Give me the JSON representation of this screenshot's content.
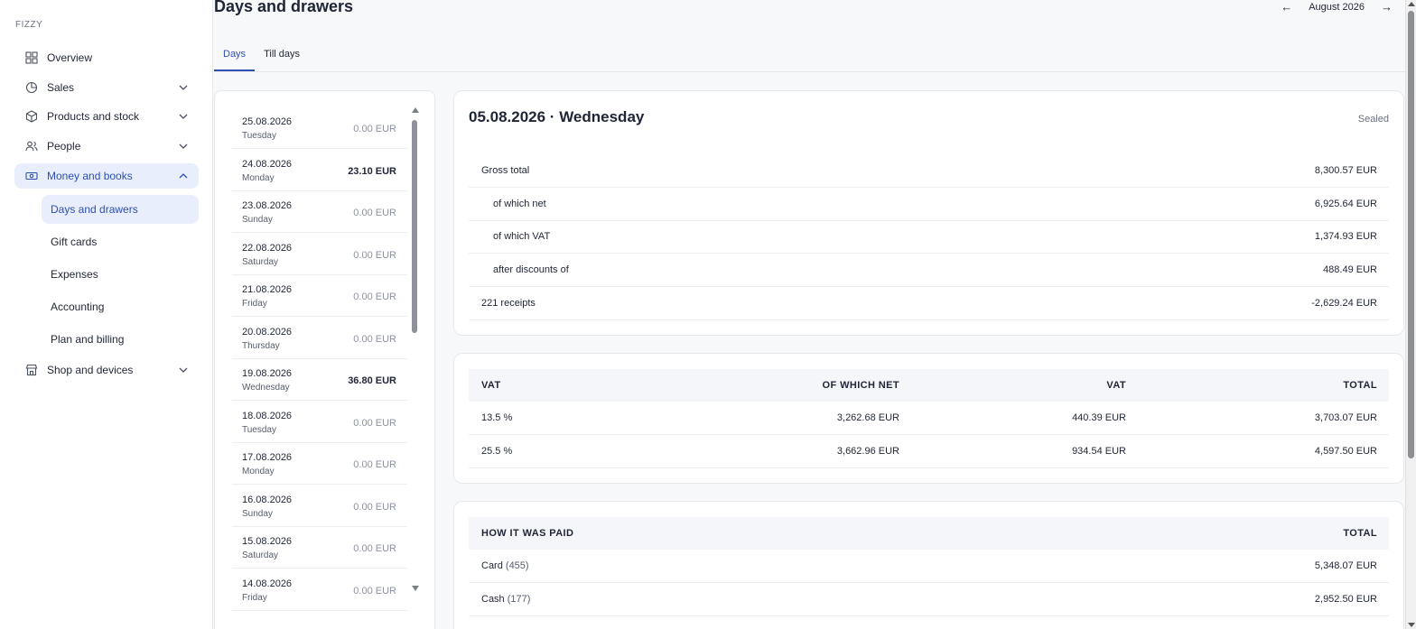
{
  "app": {
    "brand": "FIZZY"
  },
  "sidebar": {
    "items": [
      {
        "label": "Overview",
        "icon": "grid-icon"
      },
      {
        "label": "Sales",
        "icon": "pie-chart-icon"
      },
      {
        "label": "Products and stock",
        "icon": "box-icon"
      },
      {
        "label": "People",
        "icon": "users-icon"
      },
      {
        "label": "Money and books",
        "icon": "cash-icon"
      },
      {
        "label": "Shop and devices",
        "icon": "store-icon"
      }
    ],
    "sub_items": [
      {
        "label": "Days and drawers"
      },
      {
        "label": "Gift cards"
      },
      {
        "label": "Expenses"
      },
      {
        "label": "Accounting"
      },
      {
        "label": "Plan and billing"
      }
    ]
  },
  "header": {
    "title": "Days and drawers",
    "month": "August 2026",
    "prev_arrow": "←",
    "next_arrow": "→"
  },
  "tabs": [
    {
      "label": "Days"
    },
    {
      "label": "Till days"
    }
  ],
  "days": [
    {
      "date": "25.08.2026",
      "weekday": "Tuesday",
      "amount": "0.00 EUR"
    },
    {
      "date": "24.08.2026",
      "weekday": "Monday",
      "amount": "23.10 EUR"
    },
    {
      "date": "23.08.2026",
      "weekday": "Sunday",
      "amount": "0.00 EUR"
    },
    {
      "date": "22.08.2026",
      "weekday": "Saturday",
      "amount": "0.00 EUR"
    },
    {
      "date": "21.08.2026",
      "weekday": "Friday",
      "amount": "0.00 EUR"
    },
    {
      "date": "20.08.2026",
      "weekday": "Thursday",
      "amount": "0.00 EUR"
    },
    {
      "date": "19.08.2026",
      "weekday": "Wednesday",
      "amount": "36.80 EUR"
    },
    {
      "date": "18.08.2026",
      "weekday": "Tuesday",
      "amount": "0.00 EUR"
    },
    {
      "date": "17.08.2026",
      "weekday": "Monday",
      "amount": "0.00 EUR"
    },
    {
      "date": "16.08.2026",
      "weekday": "Sunday",
      "amount": "0.00 EUR"
    },
    {
      "date": "15.08.2026",
      "weekday": "Saturday",
      "amount": "0.00 EUR"
    },
    {
      "date": "14.08.2026",
      "weekday": "Friday",
      "amount": "0.00 EUR"
    }
  ],
  "detail": {
    "title": "05.08.2026 · Wednesday",
    "status": "Sealed",
    "summary": [
      {
        "label": "Gross total",
        "value": "8,300.57 EUR"
      },
      {
        "label": "of which net",
        "value": "6,925.64 EUR"
      },
      {
        "label": "of which VAT",
        "value": "1,374.93 EUR"
      },
      {
        "label": "after discounts of",
        "value": "488.49 EUR"
      },
      {
        "label": "221 receipts",
        "value": "-2,629.24 EUR"
      }
    ],
    "vat_table": {
      "headers": [
        "VAT",
        "OF WHICH NET",
        "VAT",
        "TOTAL"
      ],
      "rows": [
        [
          "13.5 %",
          "3,262.68 EUR",
          "440.39 EUR",
          "3,703.07 EUR"
        ],
        [
          "25.5 %",
          "3,662.96 EUR",
          "934.54 EUR",
          "4,597.50 EUR"
        ]
      ]
    },
    "payment_table": {
      "headers": [
        "HOW IT WAS PAID",
        "TOTAL"
      ],
      "rows": [
        {
          "method": "Card",
          "count": "(455)",
          "total": "5,348.07 EUR"
        },
        {
          "method": "Cash",
          "count": "(177)",
          "total": "2,952.50 EUR"
        }
      ]
    }
  },
  "colors": {
    "accent": "#2d4fb3",
    "active_bg": "#e8eefb",
    "text": "#1f2535",
    "muted": "#8b92a0"
  }
}
